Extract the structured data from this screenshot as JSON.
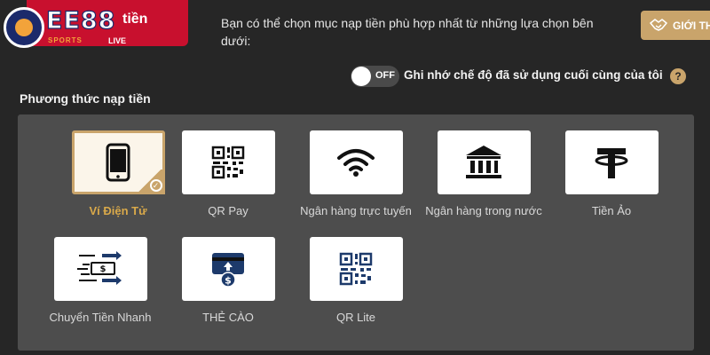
{
  "header": {
    "logo_text": "EE88",
    "logo_subtext": "SPORTS",
    "logo_live": "LIVE",
    "title": "tiền",
    "description": "Bạn có thể chọn mục nạp tiền phù hợp nhất từ những lựa chọn bên dưới:",
    "intro_button": "GIỚI TH"
  },
  "toggle": {
    "state": "OFF",
    "label": "Ghi nhớ chế độ đã sử dụng cuối cùng của tôi",
    "help": "?"
  },
  "section_title": "Phương thức nạp tiền",
  "methods": [
    {
      "label": "Ví Điện Tử",
      "icon": "smartphone-icon",
      "selected": true
    },
    {
      "label": "QR Pay",
      "icon": "qr-code-icon",
      "selected": false
    },
    {
      "label": "Ngân hàng trực tuyến",
      "icon": "wifi-icon",
      "selected": false
    },
    {
      "label": "Ngân hàng trong nước",
      "icon": "bank-icon",
      "selected": false
    },
    {
      "label": "Tiền Ảo",
      "icon": "tether-icon",
      "selected": false
    },
    {
      "label": "Chuyển Tiền Nhanh",
      "icon": "fast-transfer-icon",
      "selected": false
    },
    {
      "label": "THẺ CÀO",
      "icon": "scratch-card-icon",
      "selected": false
    },
    {
      "label": "QR Lite",
      "icon": "qr-code-icon",
      "selected": false
    }
  ],
  "colors": {
    "accent_gold": "#c9a46b",
    "brand_red": "#c8102e",
    "background": "#262626",
    "panel": "#4d4d4d"
  }
}
